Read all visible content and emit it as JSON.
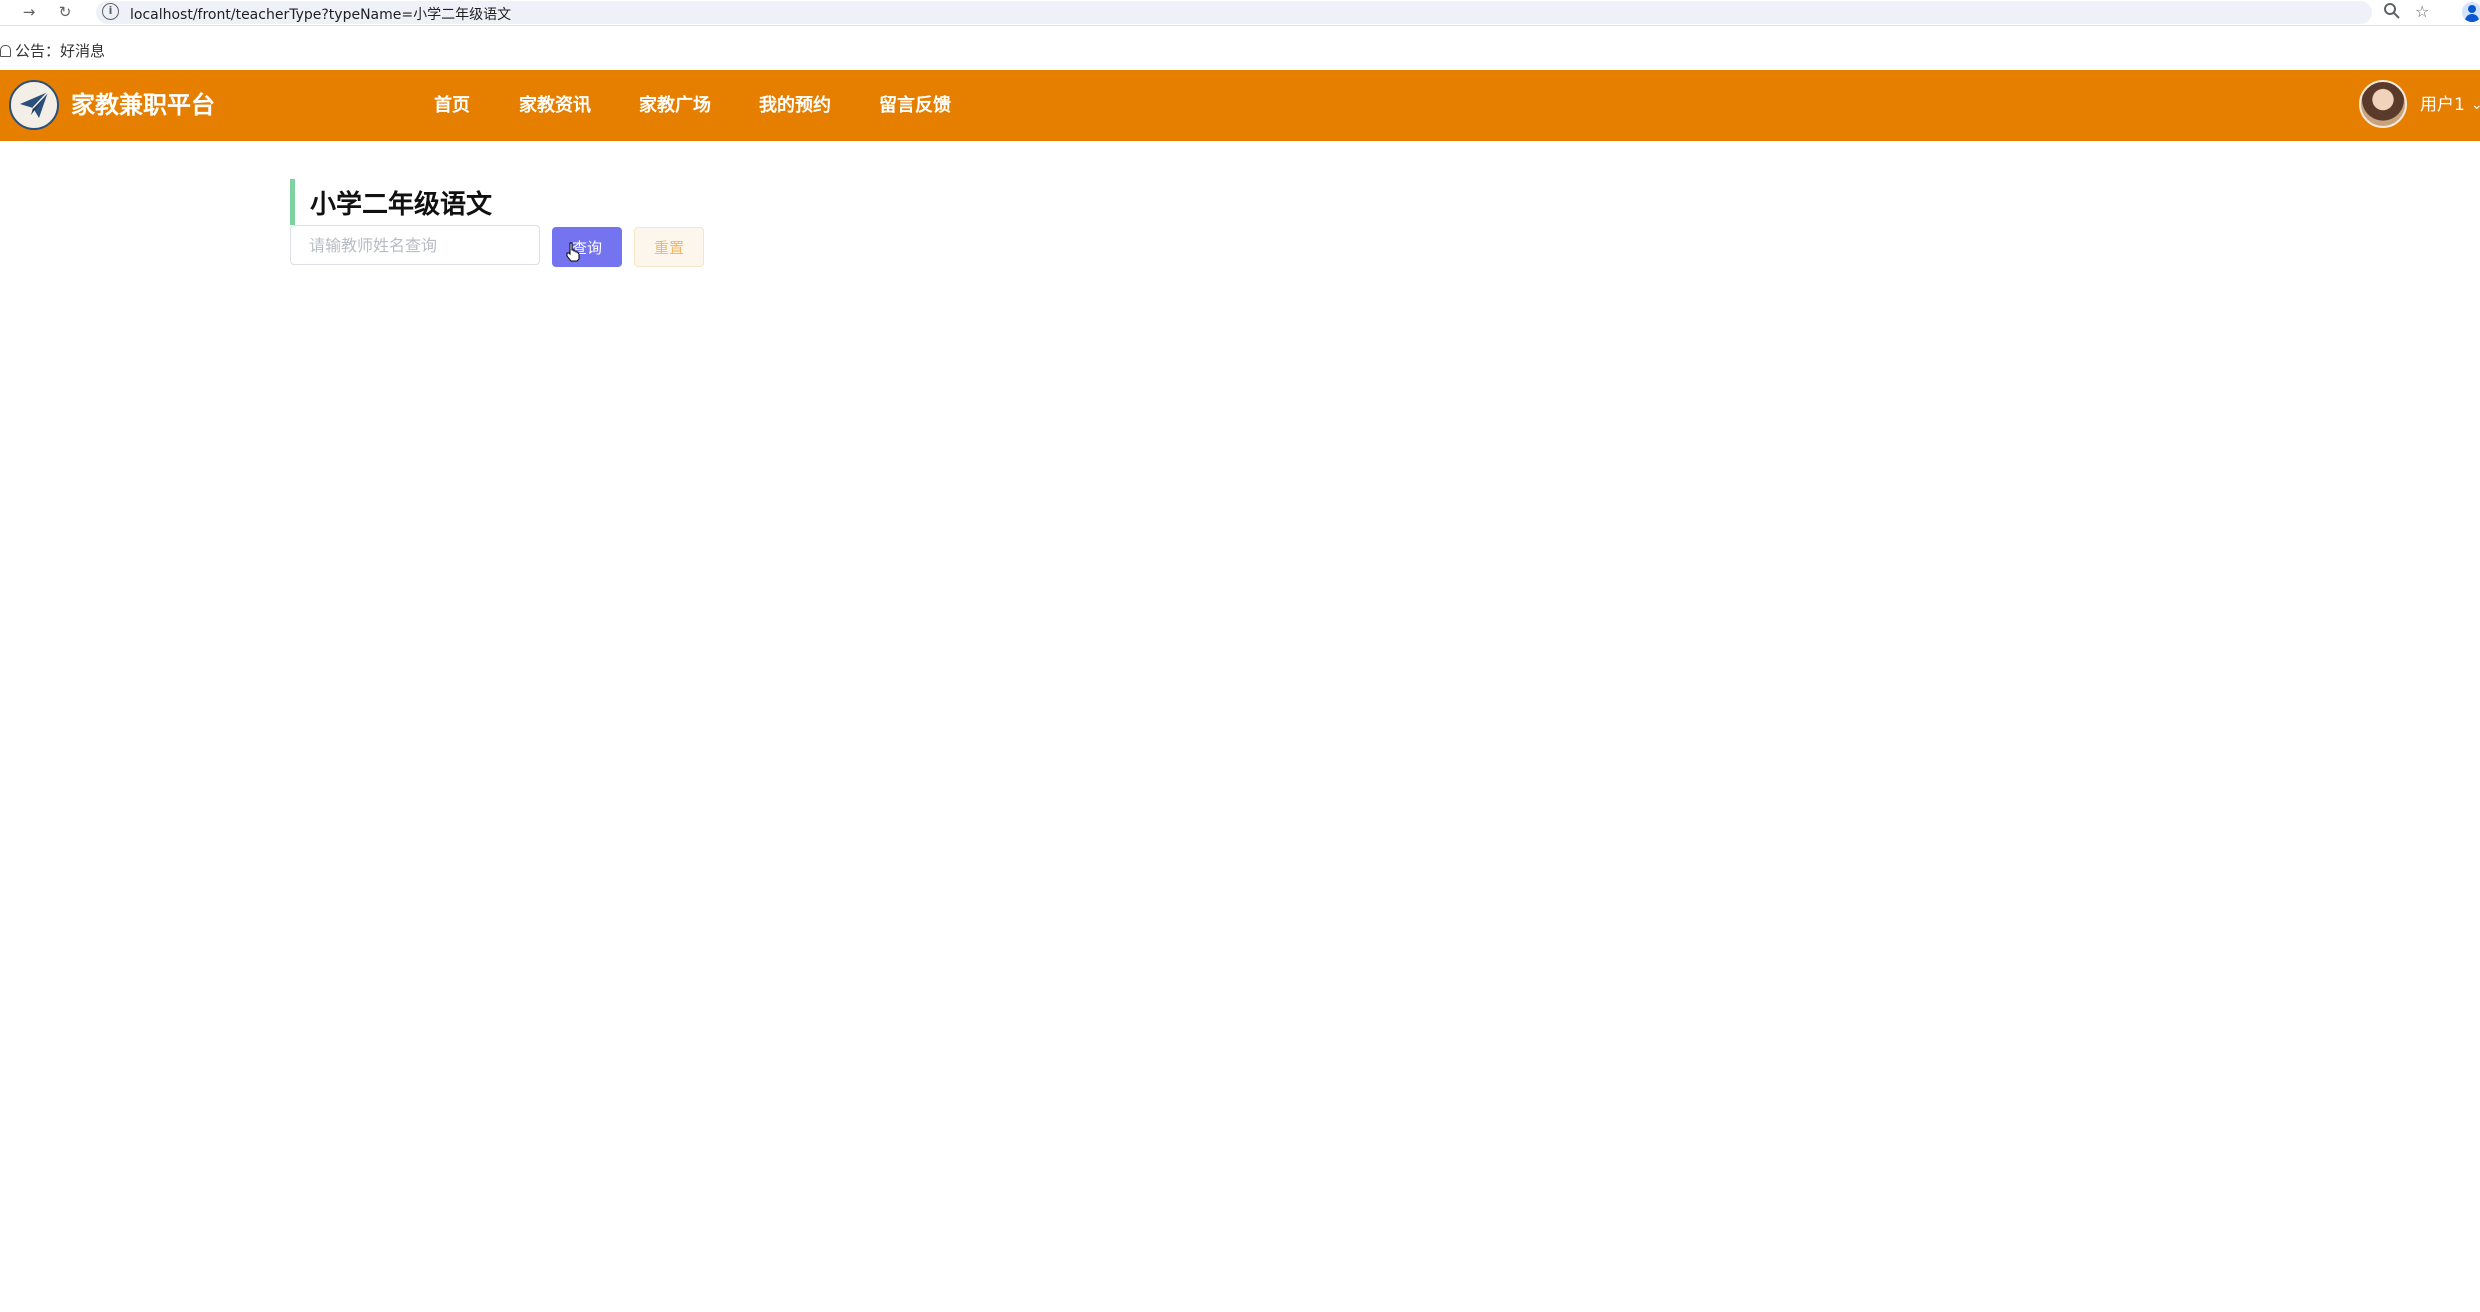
{
  "browser": {
    "url": "localhost/front/teacherType?typeName=小学二年级语文",
    "back_icon": "arrow-right-icon",
    "reload_icon": "reload-icon",
    "zoom_icon": "zoom-icon",
    "bookmark_icon": "star-icon",
    "profile_icon": "profile-icon"
  },
  "notice": {
    "label": "公告：",
    "text": "好消息"
  },
  "header": {
    "site_name": "家教兼职平台",
    "logo_icon": "paper-plane-icon",
    "background_color": "#e67e00",
    "menu": [
      {
        "label": "首页"
      },
      {
        "label": "家教资讯"
      },
      {
        "label": "家教广场"
      },
      {
        "label": "我的预约"
      },
      {
        "label": "留言反馈"
      }
    ],
    "username": "用户1"
  },
  "main": {
    "section_title": "小学二年级语文",
    "search": {
      "placeholder": "请输教师姓名查询",
      "value": ""
    },
    "query_button": "查询",
    "reset_button": "重置",
    "accent_color": "#7fd1a0",
    "query_button_color": "#7574f0"
  }
}
